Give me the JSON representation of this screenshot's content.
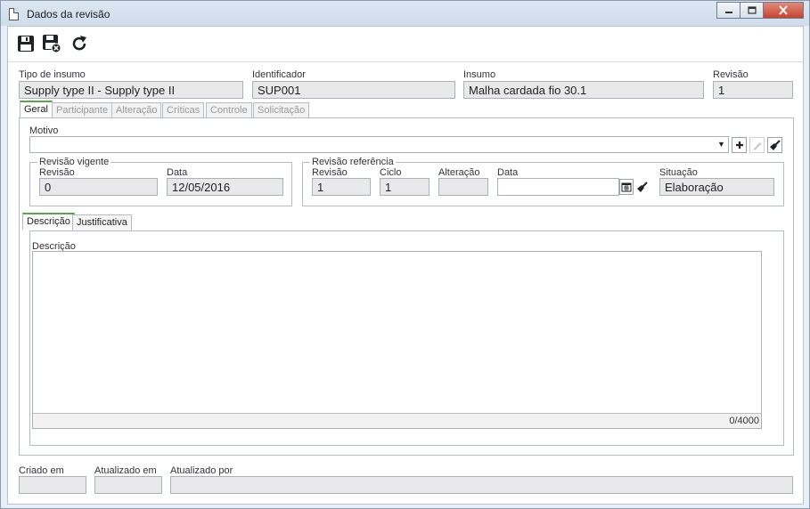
{
  "window": {
    "title": "Dados da revisão",
    "minimize_icon": "minimize-icon",
    "maximize_icon": "maximize-icon",
    "close_icon": "close-icon"
  },
  "toolbar": {
    "save_icon": "save-icon",
    "save_close_icon": "save-close-icon",
    "refresh_icon": "refresh-icon"
  },
  "header": {
    "tipo_label": "Tipo de insumo",
    "tipo_value": "Supply type II - Supply type II",
    "identificador_label": "Identificador",
    "identificador_value": "SUP001",
    "insumo_label": "Insumo",
    "insumo_value": "Malha cardada fio 30.1",
    "revisao_label": "Revisão",
    "revisao_value": "1"
  },
  "tabs": [
    "Geral",
    "Participante",
    "Alteração",
    "Críticas",
    "Controle",
    "Solicitação"
  ],
  "geral": {
    "motivo_label": "Motivo",
    "motivo_value": "",
    "revisao_vigente": {
      "legend": "Revisão vigente",
      "revisao_label": "Revisão",
      "revisao_value": "0",
      "data_label": "Data",
      "data_value": "12/05/2016"
    },
    "revisao_referencia": {
      "legend": "Revisão referência",
      "revisao_label": "Revisão",
      "revisao_value": "1",
      "ciclo_label": "Ciclo",
      "ciclo_value": "1",
      "alteracao_label": "Alteração",
      "alteracao_value": "",
      "data_label": "Data",
      "data_value": "",
      "situacao_label": "Situação",
      "situacao_value": "Elaboração"
    },
    "subtabs": [
      "Descrição",
      "Justificativa"
    ],
    "descricao_label": "Descrição",
    "descricao_value": "",
    "counter": "0/4000"
  },
  "footer": {
    "criado_label": "Criado em",
    "criado_value": "",
    "atualizado_label": "Atualizado em",
    "atualizado_value": "",
    "atualizado_por_label": "Atualizado por",
    "atualizado_por_value": ""
  }
}
